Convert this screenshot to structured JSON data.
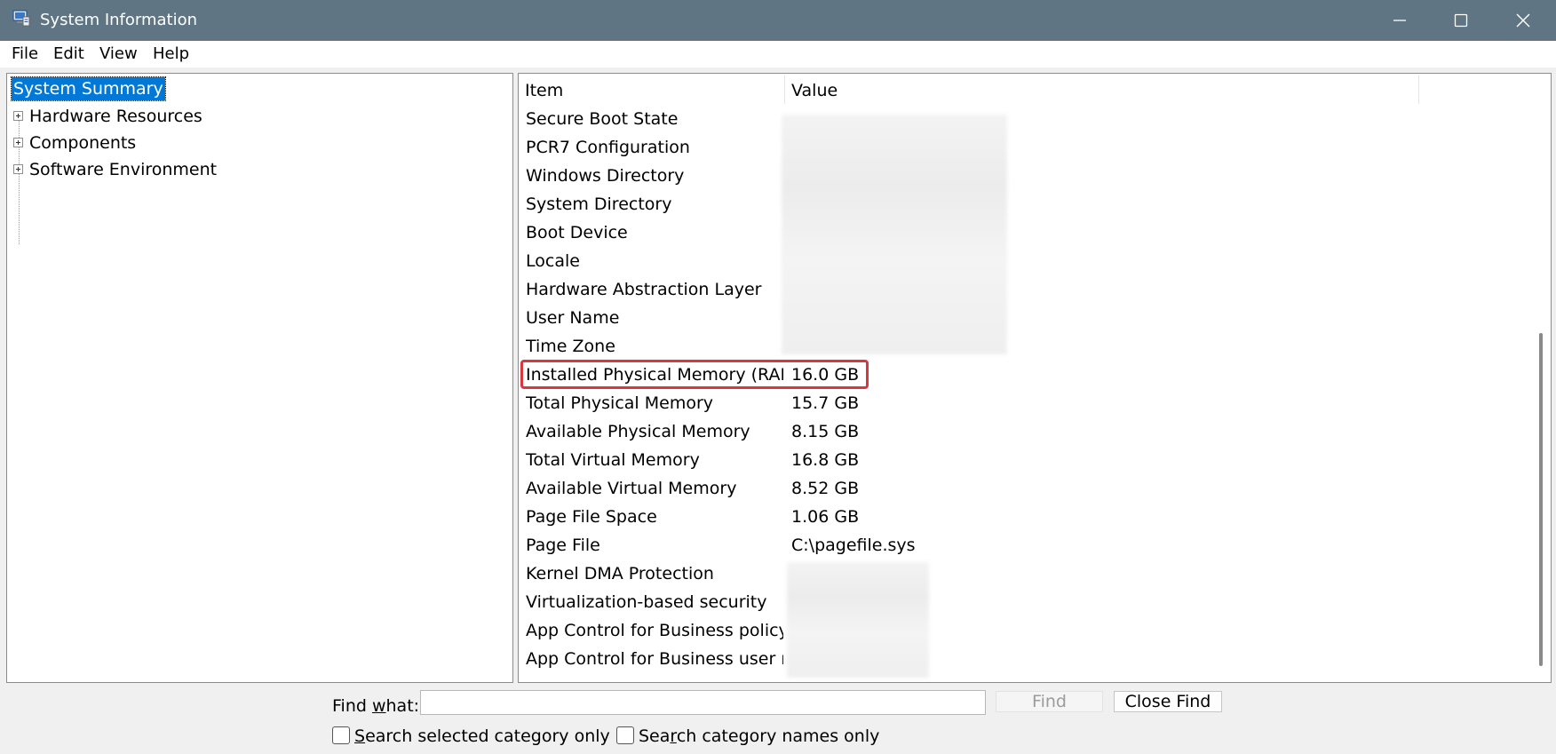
{
  "window": {
    "title": "System Information",
    "icon": "system-information-icon",
    "controls": [
      "minimize-icon",
      "maximize-icon",
      "close-icon"
    ]
  },
  "menu": {
    "items": [
      {
        "label": "File"
      },
      {
        "label": "Edit"
      },
      {
        "label": "View"
      },
      {
        "label": "Help"
      }
    ]
  },
  "tree": {
    "selected": "System Summary",
    "nodes": [
      {
        "label": "Hardware Resources"
      },
      {
        "label": "Components"
      },
      {
        "label": "Software Environment"
      }
    ]
  },
  "list": {
    "columns": [
      "Item",
      "Value"
    ],
    "rows": [
      {
        "item": "Secure Boot State",
        "value": ""
      },
      {
        "item": "PCR7 Configuration",
        "value": ""
      },
      {
        "item": "Windows Directory",
        "value": ""
      },
      {
        "item": "System Directory",
        "value": ""
      },
      {
        "item": "Boot Device",
        "value": ""
      },
      {
        "item": "Locale",
        "value": ""
      },
      {
        "item": "Hardware Abstraction Layer",
        "value": ""
      },
      {
        "item": "User Name",
        "value": ""
      },
      {
        "item": "Time Zone",
        "value": ""
      },
      {
        "item": "Installed Physical Memory (RAM)",
        "value": "16.0 GB"
      },
      {
        "item": "Total Physical Memory",
        "value": "15.7 GB"
      },
      {
        "item": "Available Physical Memory",
        "value": "8.15 GB"
      },
      {
        "item": "Total Virtual Memory",
        "value": "16.8 GB"
      },
      {
        "item": "Available Virtual Memory",
        "value": "8.52 GB"
      },
      {
        "item": "Page File Space",
        "value": "1.06 GB"
      },
      {
        "item": "Page File",
        "value": "C:\\pagefile.sys"
      },
      {
        "item": "Kernel DMA Protection",
        "value": ""
      },
      {
        "item": "Virtualization-based security",
        "value": ""
      },
      {
        "item": "App Control for Business policy",
        "value": ""
      },
      {
        "item": "App Control for Business user m...",
        "value": ""
      }
    ],
    "highlighted_item": "Installed Physical Memory (RAM)"
  },
  "find": {
    "label_prefix": "Find ",
    "label_accel": "w",
    "label_suffix": "hat:",
    "value": "",
    "find_button": "Find",
    "close_button": "Close Find",
    "option1_prefix": "",
    "option1_accel": "S",
    "option1_suffix": "earch selected category only",
    "option2_prefix": "Sea",
    "option2_accel": "r",
    "option2_suffix": "ch category names only"
  },
  "colors": {
    "titlebar": "#5f7584",
    "selection": "#0078d7",
    "highlight_border": "#d9373e"
  }
}
